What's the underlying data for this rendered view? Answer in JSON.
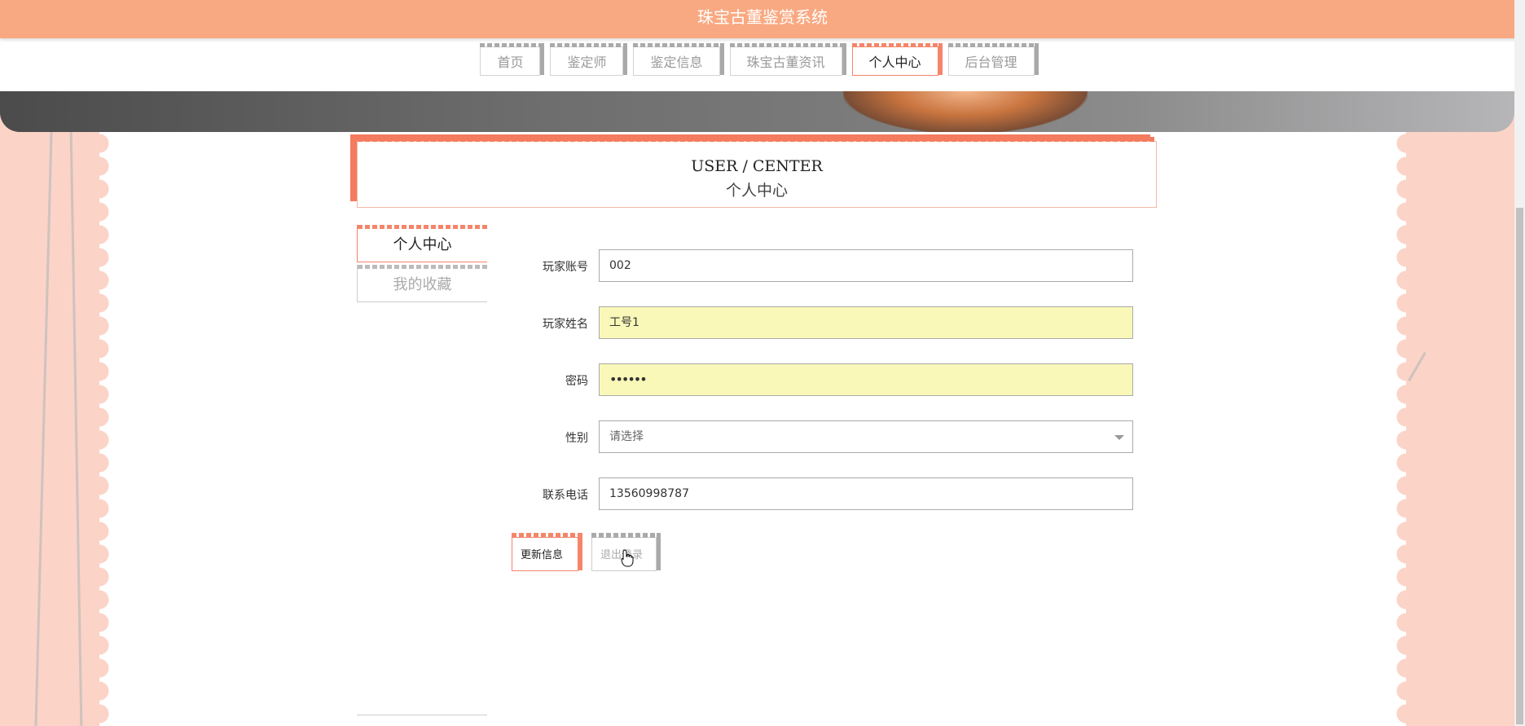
{
  "header": {
    "title": "珠宝古董鉴赏系统"
  },
  "nav": {
    "items": [
      {
        "label": "首页"
      },
      {
        "label": "鉴定师"
      },
      {
        "label": "鉴定信息"
      },
      {
        "label": "珠宝古董资讯"
      },
      {
        "label": "个人中心"
      },
      {
        "label": "后台管理"
      }
    ],
    "active": "个人中心"
  },
  "section": {
    "title_en": "USER / CENTER",
    "title_cn": "个人中心"
  },
  "sidebar": {
    "items": [
      {
        "label": "个人中心"
      },
      {
        "label": "我的收藏"
      }
    ]
  },
  "form": {
    "account": {
      "label": "玩家账号",
      "value": "002"
    },
    "name": {
      "label": "玩家姓名",
      "value": "工号1"
    },
    "password": {
      "label": "密码",
      "value": "••••••"
    },
    "gender": {
      "label": "性别",
      "value": "请选择"
    },
    "phone": {
      "label": "联系电话",
      "value": "13560998787"
    }
  },
  "buttons": {
    "update": "更新信息",
    "logout": "退出登录"
  },
  "colors": {
    "header": "#f9a982",
    "accent": "#f47b5e",
    "autofill": "#faf8b8",
    "background": "#fbd3c7"
  }
}
